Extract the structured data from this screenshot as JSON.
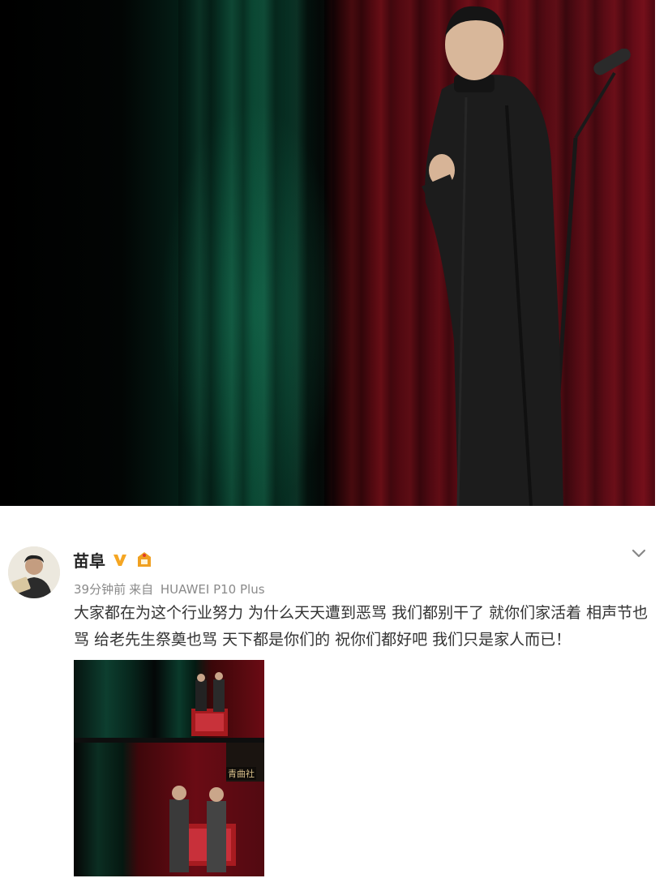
{
  "post": {
    "username": "苗阜",
    "time": "39分钟前",
    "source_prefix": "来自",
    "source_device": "HUAWEI P10 Plus",
    "text": "大家都在为这个行业努力 为什么天天遭到恶骂 我们都别干了 就你们家活着 相声节也骂 给老先生祭奠也骂 天下都是你们的 祝你们都好吧 我们只是家人而已！",
    "image_overlay_text": "青曲社"
  },
  "colors": {
    "verified_badge": "#f5a623",
    "vip_badge": "#f0a020",
    "text": "#333333",
    "meta": "#8a8a8a"
  }
}
